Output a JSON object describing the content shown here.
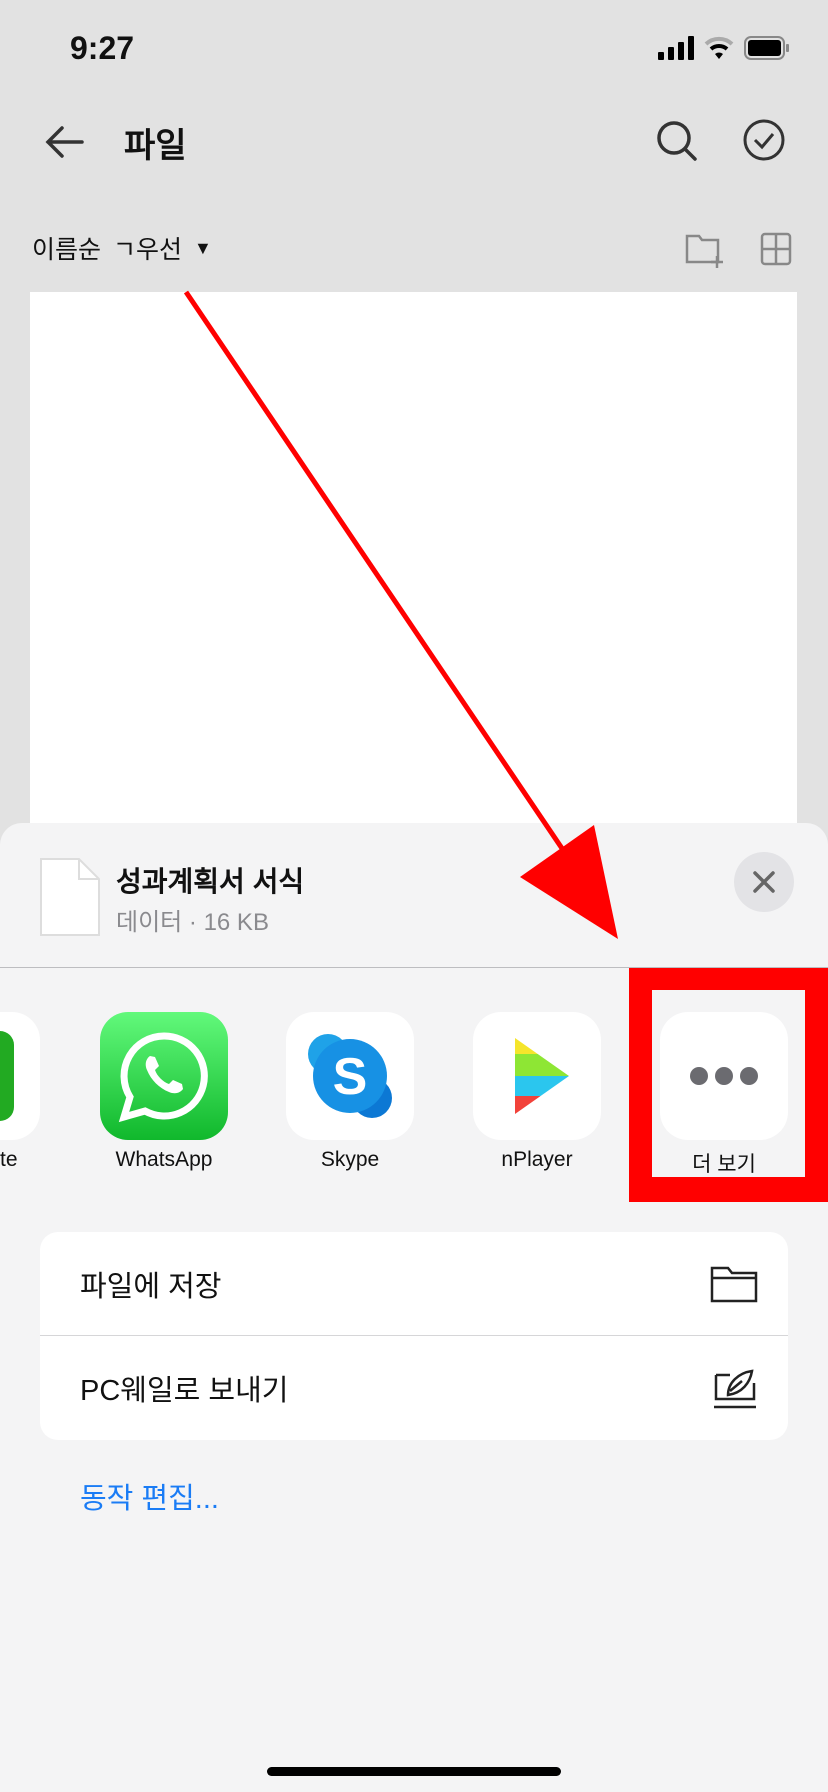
{
  "status_bar": {
    "time": "9:27"
  },
  "nav": {
    "title": "파일"
  },
  "sort": {
    "label": "이름순",
    "order": "ㄱ우선"
  },
  "share_sheet": {
    "file_name": "성과계획서 서식",
    "file_info": "데이터 · 16 KB",
    "apps": [
      {
        "label": "te",
        "icon": "partial-green-app-icon"
      },
      {
        "label": "WhatsApp",
        "icon": "whatsapp-icon"
      },
      {
        "label": "Skype",
        "icon": "skype-icon"
      },
      {
        "label": "nPlayer",
        "icon": "nplayer-icon"
      },
      {
        "label": "더 보기",
        "icon": "more-dots-icon"
      }
    ],
    "actions": [
      {
        "label": "파일에 저장",
        "icon": "folder-icon"
      },
      {
        "label": "PC웨일로 보내기",
        "icon": "whale-send-icon"
      }
    ],
    "edit_actions": "동작 편집..."
  },
  "annotation": {
    "color": "#ff0000"
  }
}
